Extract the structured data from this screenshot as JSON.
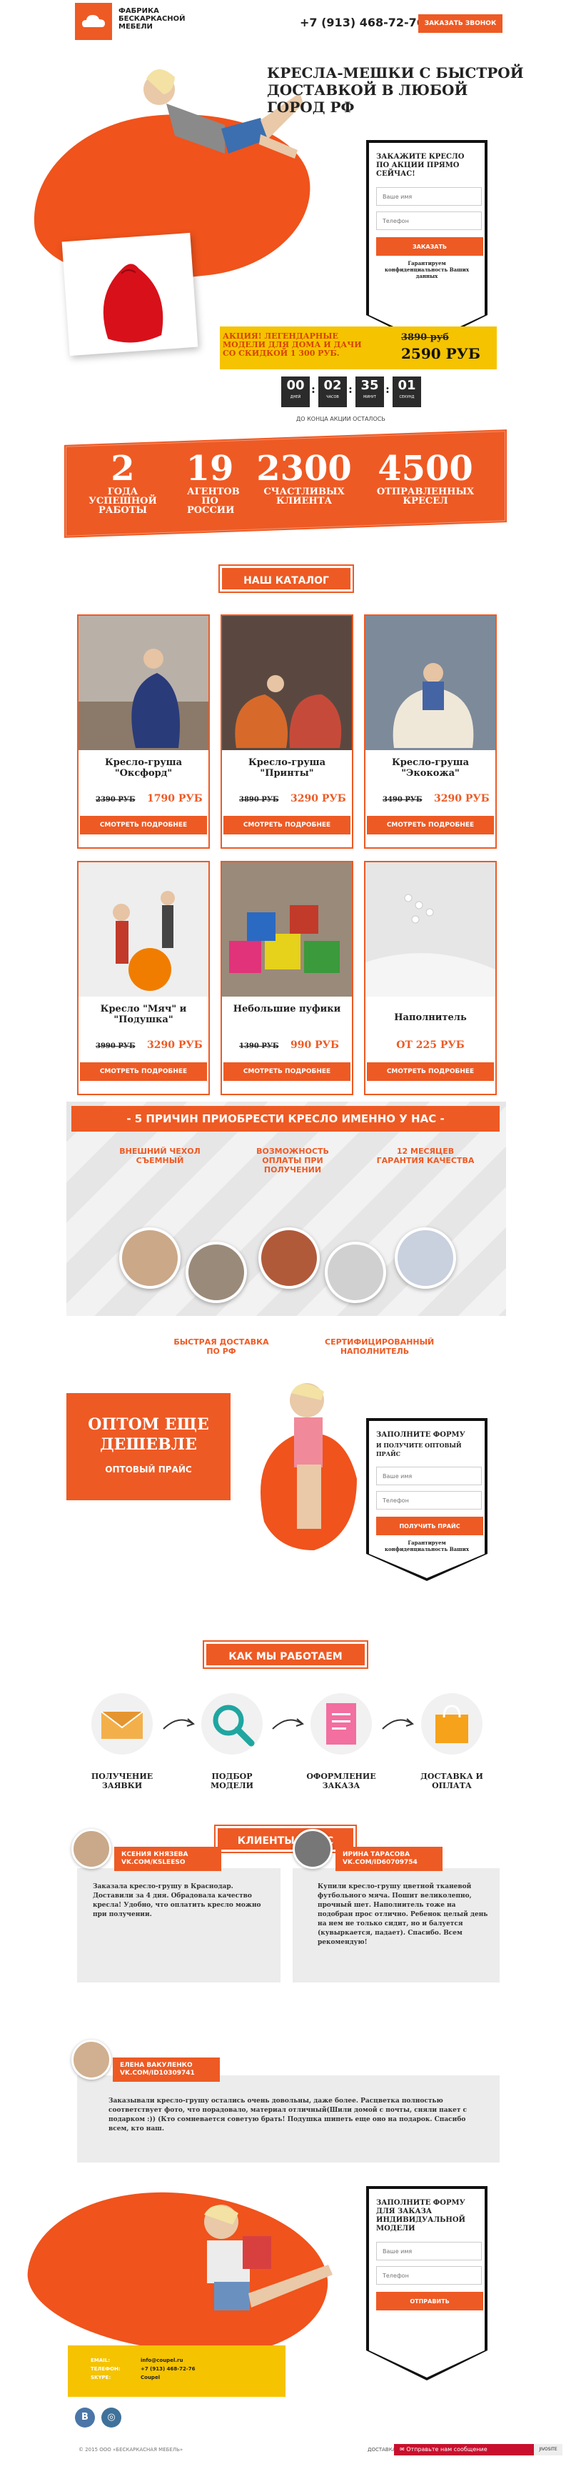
{
  "header": {
    "logo_text": "Фабрика бескаркасной мебели",
    "phone": "+7 (913) 468-72-76",
    "callback_button": "ЗАКАЗАТЬ ЗВОНОК"
  },
  "hero": {
    "title": "КРЕСЛА-МЕШКИ С БЫСТРОЙ ДОСТАВКОЙ В ЛЮБОЙ ГОРОД РФ",
    "form": {
      "title": "ЗАКАЖИТЕ КРЕСЛО ПО АКЦИИ ПРЯМО СЕЙЧАС!",
      "name_placeholder": "Ваше имя",
      "phone_placeholder": "Телефон",
      "submit": "ЗАКАЗАТЬ",
      "note": "Гарантируем конфиденциальность Ваших данных"
    },
    "promo": {
      "text": "АКЦИЯ! ЛЕГЕНДАРНЫЕ МОДЕЛИ ДЛЯ ДОМА И ДАЧИ СО СКИДКОЙ 1 300 РУБ.",
      "old_price": "3890 руб",
      "new_price": "2590 РУБ"
    },
    "timer": {
      "days": "00",
      "hours": "02",
      "minutes": "35",
      "seconds": "01",
      "days_label": "ДНЕЙ",
      "hours_label": "ЧАСОВ",
      "minutes_label": "МИНУТ",
      "seconds_label": "СЕКУНД",
      "caption": "ДО КОНЦА АКЦИИ ОСТАЛОСЬ"
    }
  },
  "stats": [
    {
      "num": "2",
      "label": "ГОДА УСПЕШНОЙ РАБОТЫ"
    },
    {
      "num": "19",
      "label": "АГЕНТОВ ПО РОССИИ"
    },
    {
      "num": "2300",
      "label": "СЧАСТЛИВЫХ КЛИЕНТА"
    },
    {
      "num": "4500",
      "label": "ОТПРАВЛЕННЫХ КРЕСЕЛ"
    }
  ],
  "catalog": {
    "title": "НАШ КАТАЛОГ",
    "more_label": "СМОТРЕТЬ ПОДРОБНЕЕ",
    "items": [
      {
        "name": "Кресло-груша \"Оксфорд\"",
        "old": "2390 РУБ",
        "new": "1790 РУБ"
      },
      {
        "name": "Кресло-груша \"Принты\"",
        "old": "3890 РУБ",
        "new": "3290 РУБ"
      },
      {
        "name": "Кресло-груша \"Экокожа\"",
        "old": "3490 РУБ",
        "new": "3290 РУБ"
      },
      {
        "name": "Кресло \"Мяч\" и \"Подушка\"",
        "old": "3990 РУБ",
        "new": "3290 РУБ"
      },
      {
        "name": "Небольшие пуфики",
        "old": "1390 РУБ",
        "new": "990 РУБ"
      },
      {
        "name": "Наполнитель",
        "old": "",
        "new": "ОТ 225 РУБ"
      }
    ]
  },
  "reasons": {
    "title": "- 5 ПРИЧИН ПРИОБРЕСТИ КРЕСЛО ИМЕННО У НАС -",
    "items": [
      "ВНЕШНИЙ ЧЕХОЛ СЪЕМНЫЙ",
      "ВОЗМОЖНОСТЬ ОПЛАТЫ ПРИ ПОЛУЧЕНИИ",
      "12 МЕСЯЦЕВ ГАРАНТИЯ КАЧЕСТВА",
      "БЫСТРАЯ ДОСТАВКА ПО РФ",
      "СЕРТИФИЦИРОВАННЫЙ НАПОЛНИТЕЛЬ"
    ]
  },
  "wholesale": {
    "title": "ОПТОМ ЕЩЕ ДЕШЕВЛЕ",
    "subtitle": "ОПТОВЫЙ ПРАЙС",
    "form": {
      "title": "ЗАПОЛНИТЕ ФОРМУ",
      "subtitle": "И ПОЛУЧИТЕ ОПТОВЫЙ ПРАЙС",
      "name_placeholder": "Ваше имя",
      "phone_placeholder": "Телефон",
      "submit": "ПОЛУЧИТЬ ПРАЙС",
      "note": "Гарантируем конфиденциальность Ваших данных"
    }
  },
  "how": {
    "title": "КАК МЫ РАБОТАЕМ",
    "steps": [
      "ПОЛУЧЕНИЕ ЗАЯВКИ",
      "ПОДБОР МОДЕЛИ",
      "ОФОРМЛЕНИЕ ЗАКАЗА",
      "ДОСТАВКА И ОПЛАТА"
    ]
  },
  "reviews": {
    "title": "КЛИЕНТЫ О НАС",
    "items": [
      {
        "name": "КСЕНИЯ КНЯЗЕВА VK.COM/KSLEESO",
        "text": "Заказала кресло-грушу в Краснодар. Доставили за 4 дня. Обрадовала качество кресла! Удобно, что оплатить кресло можно при получении."
      },
      {
        "name": "ИРИНА ТАРАСОВА VK.COM/ID60709754",
        "text": "Купили кресло-грушу цветной тканевой футбольного мяча. Пошит великолепно, прочный шет. Наполнитель тоже на подобран прос отлично. Ребенок целый день на нем не только сидит, но и балуется (кувыркается, падает). Спасибо. Всем рекомендую!"
      },
      {
        "name": "ЕЛЕНА ВАКУЛЕНКО VK.COM/ID10309741",
        "text": "Заказывали кресло-грушу остались очень довольны, даже более. Расцветка полностью соответствует фото, что порадовало, материал отличный(Шили домой с почты, сняли пакет с подарком :)) (Кто сомневается советую брать! Подушка шипеть еще оно на подарок. Спасибо всем, кто наш."
      }
    ]
  },
  "bottom_form": {
    "title": "ЗАПОЛНИТЕ ФОРМУ ДЛЯ ЗАКАЗА ИНДИВИДУАЛЬНОЙ МОДЕЛИ",
    "name_placeholder": "Ваше имя",
    "phone_placeholder": "Телефон",
    "submit": "ОТПРАВИТЬ"
  },
  "contacts": {
    "email_label": "EMAIL:",
    "email": "info@coupel.ru",
    "phone_label": "ТЕЛЕФОН:",
    "phone": "+7 (913) 468-72-76",
    "skype_label": "SKYPE:",
    "skype": "Coupel"
  },
  "social": {
    "vk": "В",
    "instagram": "◎"
  },
  "footer": {
    "copyright": "© 2015 ООО «БЕСКАРКАСНАЯ МЕБЕЛЬ»",
    "chat_label": "Отправьте нам сообщение",
    "sitemap": "ДОСТАВКА",
    "badge": "JIVOSITE"
  },
  "colors": {
    "accent": "#ee5a24",
    "yellow": "#f5c300",
    "dark": "#111111"
  }
}
